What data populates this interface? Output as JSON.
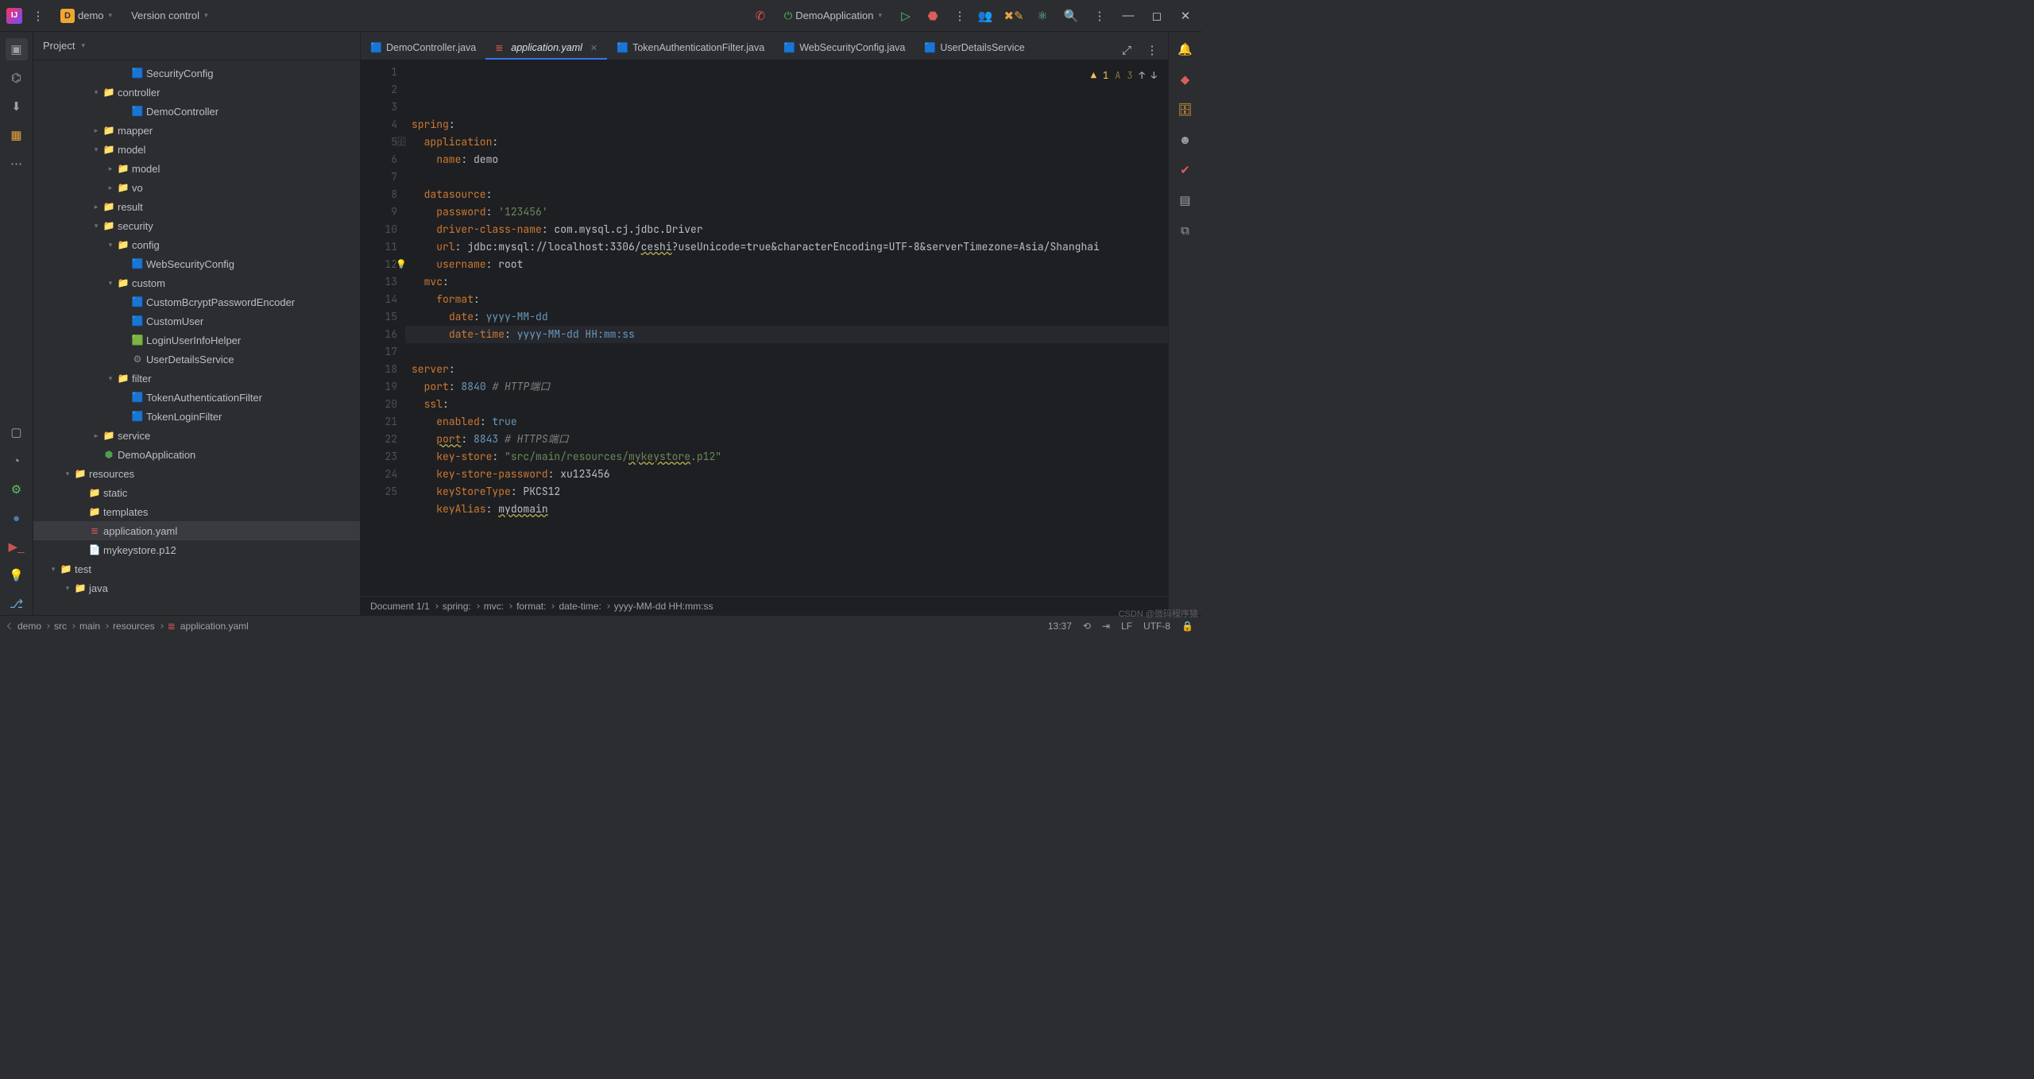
{
  "titlebar": {
    "project_letter": "D",
    "project_name": "demo",
    "vcs": "Version control",
    "run_config": "DemoApplication"
  },
  "sidebar": {
    "title": "Project"
  },
  "tree": [
    {
      "indent": 6,
      "chev": "",
      "icon": "🟦",
      "label": "SecurityConfig",
      "iconColor": "#40a0d8"
    },
    {
      "indent": 4,
      "chev": "▾",
      "icon": "📁",
      "label": "controller",
      "iconColor": "#b07b46"
    },
    {
      "indent": 6,
      "chev": "",
      "icon": "🟦",
      "label": "DemoController",
      "iconColor": "#40a0d8"
    },
    {
      "indent": 4,
      "chev": "▸",
      "icon": "📁",
      "label": "mapper",
      "iconColor": "#4f9e4f"
    },
    {
      "indent": 4,
      "chev": "▾",
      "icon": "📁",
      "label": "model",
      "iconColor": "#4f9e4f"
    },
    {
      "indent": 5,
      "chev": "▸",
      "icon": "📁",
      "label": "model",
      "iconColor": "#4f9e4f"
    },
    {
      "indent": 5,
      "chev": "▸",
      "icon": "📁",
      "label": "vo",
      "iconColor": "#4f9e4f"
    },
    {
      "indent": 4,
      "chev": "▸",
      "icon": "📁",
      "label": "result",
      "iconColor": "#b07b46"
    },
    {
      "indent": 4,
      "chev": "▾",
      "icon": "📁",
      "label": "security",
      "iconColor": "#b07b46"
    },
    {
      "indent": 5,
      "chev": "▾",
      "icon": "📁",
      "label": "config",
      "iconColor": "#4f9e4f"
    },
    {
      "indent": 6,
      "chev": "",
      "icon": "🟦",
      "label": "WebSecurityConfig",
      "iconColor": "#40a0d8"
    },
    {
      "indent": 5,
      "chev": "▾",
      "icon": "📁",
      "label": "custom",
      "iconColor": "#4f9e4f"
    },
    {
      "indent": 6,
      "chev": "",
      "icon": "🟦",
      "label": "CustomBcryptPasswordEncoder",
      "iconColor": "#40a0d8"
    },
    {
      "indent": 6,
      "chev": "",
      "icon": "🟦",
      "label": "CustomUser",
      "iconColor": "#40a0d8"
    },
    {
      "indent": 6,
      "chev": "",
      "icon": "🟩",
      "label": "LoginUserInfoHelper",
      "iconColor": "#4f9e4f"
    },
    {
      "indent": 6,
      "chev": "",
      "icon": "⚙",
      "label": "UserDetailsService",
      "iconColor": "#8a8d93"
    },
    {
      "indent": 5,
      "chev": "▾",
      "icon": "📁",
      "label": "filter",
      "iconColor": "#4f9e4f"
    },
    {
      "indent": 6,
      "chev": "",
      "icon": "🟦",
      "label": "TokenAuthenticationFilter",
      "iconColor": "#40a0d8"
    },
    {
      "indent": 6,
      "chev": "",
      "icon": "🟦",
      "label": "TokenLoginFilter",
      "iconColor": "#40a0d8"
    },
    {
      "indent": 4,
      "chev": "▸",
      "icon": "📁",
      "label": "service",
      "iconColor": "#4f9e4f"
    },
    {
      "indent": 4,
      "chev": "",
      "icon": "⬢",
      "label": "DemoApplication",
      "iconColor": "#4f9e4f"
    },
    {
      "indent": 2,
      "chev": "▾",
      "icon": "📁",
      "label": "resources",
      "iconColor": "#6f7fd8"
    },
    {
      "indent": 3,
      "chev": "",
      "icon": "📁",
      "label": "static",
      "iconColor": "#3a8fbd"
    },
    {
      "indent": 3,
      "chev": "",
      "icon": "📁",
      "label": "templates",
      "iconColor": "#b07b46"
    },
    {
      "indent": 3,
      "chev": "",
      "icon": "≣",
      "label": "application.yaml",
      "iconColor": "#c75450",
      "selected": true
    },
    {
      "indent": 3,
      "chev": "",
      "icon": "📄",
      "label": "mykeystore.p12",
      "iconColor": "#8a8d93"
    },
    {
      "indent": 1,
      "chev": "▾",
      "icon": "📁",
      "label": "test",
      "iconColor": "#4f9e4f"
    },
    {
      "indent": 2,
      "chev": "▾",
      "icon": "📁",
      "label": "java",
      "iconColor": "#6f7fd8"
    }
  ],
  "tabs": [
    {
      "icon": "🟦",
      "label": "DemoController.java",
      "iconColor": "#40a0d8"
    },
    {
      "icon": "≣",
      "label": "application.yaml",
      "iconColor": "#c75450",
      "active": true,
      "italic": true
    },
    {
      "icon": "🟦",
      "label": "TokenAuthenticationFilter.java",
      "iconColor": "#40a0d8"
    },
    {
      "icon": "🟦",
      "label": "WebSecurityConfig.java",
      "iconColor": "#40a0d8"
    },
    {
      "icon": "🟦",
      "label": "UserDetailsService",
      "iconColor": "#40a0d8"
    }
  ],
  "code": [
    {
      "n": 1,
      "seg": [
        {
          "t": "spring",
          "c": "k-key"
        },
        {
          "t": ":",
          "c": ""
        }
      ]
    },
    {
      "n": 2,
      "seg": [
        {
          "t": "  ",
          "c": ""
        },
        {
          "t": "application",
          "c": "k-key"
        },
        {
          "t": ":",
          "c": ""
        }
      ]
    },
    {
      "n": 3,
      "seg": [
        {
          "t": "    ",
          "c": ""
        },
        {
          "t": "name",
          "c": "k-key"
        },
        {
          "t": ": demo",
          "c": ""
        }
      ]
    },
    {
      "n": 4,
      "seg": []
    },
    {
      "n": 5,
      "seg": [
        {
          "t": "  ",
          "c": ""
        },
        {
          "t": "datasource",
          "c": "k-key"
        },
        {
          "t": ":",
          "c": ""
        }
      ],
      "gicon": "🗄"
    },
    {
      "n": 6,
      "seg": [
        {
          "t": "    ",
          "c": ""
        },
        {
          "t": "password",
          "c": "k-key"
        },
        {
          "t": ": ",
          "c": ""
        },
        {
          "t": "'123456'",
          "c": "k-str"
        }
      ]
    },
    {
      "n": 7,
      "seg": [
        {
          "t": "    ",
          "c": ""
        },
        {
          "t": "driver-class-name",
          "c": "k-key"
        },
        {
          "t": ": com.mysql.cj.jdbc.Driver",
          "c": ""
        }
      ]
    },
    {
      "n": 8,
      "seg": [
        {
          "t": "    ",
          "c": ""
        },
        {
          "t": "url",
          "c": "k-key"
        },
        {
          "t": ": jdbc:mysql://localhost:3306/",
          "c": ""
        },
        {
          "t": "ceshi",
          "c": "k-warn"
        },
        {
          "t": "?useUnicode=true&characterEncoding=UTF-8&serverTimezone=Asia/Shanghai",
          "c": ""
        }
      ]
    },
    {
      "n": 9,
      "seg": [
        {
          "t": "    ",
          "c": ""
        },
        {
          "t": "username",
          "c": "k-key"
        },
        {
          "t": ": root",
          "c": ""
        }
      ]
    },
    {
      "n": 10,
      "seg": [
        {
          "t": "  ",
          "c": ""
        },
        {
          "t": "mvc",
          "c": "k-key"
        },
        {
          "t": ":",
          "c": ""
        }
      ]
    },
    {
      "n": 11,
      "seg": [
        {
          "t": "    ",
          "c": ""
        },
        {
          "t": "format",
          "c": "k-key"
        },
        {
          "t": ":",
          "c": ""
        }
      ]
    },
    {
      "n": 12,
      "seg": [
        {
          "t": "      ",
          "c": ""
        },
        {
          "t": "date",
          "c": "k-key"
        },
        {
          "t": ": ",
          "c": ""
        },
        {
          "t": "yyyy-MM-dd",
          "c": "k-val"
        }
      ],
      "gicon": "💡"
    },
    {
      "n": 13,
      "seg": [
        {
          "t": "      ",
          "c": ""
        },
        {
          "t": "date-time",
          "c": "k-key"
        },
        {
          "t": ": ",
          "c": ""
        },
        {
          "t": "yyyy-MM-dd HH:mm:ss",
          "c": "k-val"
        }
      ],
      "cur": true
    },
    {
      "n": 14,
      "seg": []
    },
    {
      "n": 15,
      "seg": [
        {
          "t": "server",
          "c": "k-key"
        },
        {
          "t": ":",
          "c": ""
        }
      ]
    },
    {
      "n": 16,
      "seg": [
        {
          "t": "  ",
          "c": ""
        },
        {
          "t": "port",
          "c": "k-key"
        },
        {
          "t": ": ",
          "c": ""
        },
        {
          "t": "8840",
          "c": "k-val"
        },
        {
          "t": " ",
          "c": ""
        },
        {
          "t": "# HTTP端口",
          "c": "k-cmt"
        }
      ]
    },
    {
      "n": 17,
      "seg": [
        {
          "t": "  ",
          "c": ""
        },
        {
          "t": "ssl",
          "c": "k-key"
        },
        {
          "t": ":",
          "c": ""
        }
      ]
    },
    {
      "n": 18,
      "seg": [
        {
          "t": "    ",
          "c": ""
        },
        {
          "t": "enabled",
          "c": "k-key"
        },
        {
          "t": ": ",
          "c": ""
        },
        {
          "t": "true",
          "c": "k-val"
        }
      ]
    },
    {
      "n": 19,
      "seg": [
        {
          "t": "    ",
          "c": ""
        },
        {
          "t": "port",
          "c": "k-key k-warn"
        },
        {
          "t": ": ",
          "c": ""
        },
        {
          "t": "8843",
          "c": "k-val"
        },
        {
          "t": " ",
          "c": ""
        },
        {
          "t": "# HTTPS端口",
          "c": "k-cmt"
        }
      ]
    },
    {
      "n": 20,
      "seg": [
        {
          "t": "    ",
          "c": ""
        },
        {
          "t": "key-store",
          "c": "k-key"
        },
        {
          "t": ": ",
          "c": ""
        },
        {
          "t": "\"src/main/resources/",
          "c": "k-str"
        },
        {
          "t": "mykeystore",
          "c": "k-str k-warn"
        },
        {
          "t": ".p12\"",
          "c": "k-str"
        }
      ]
    },
    {
      "n": 21,
      "seg": [
        {
          "t": "    ",
          "c": ""
        },
        {
          "t": "key-store-password",
          "c": "k-key"
        },
        {
          "t": ": xu123456",
          "c": ""
        }
      ]
    },
    {
      "n": 22,
      "seg": [
        {
          "t": "    ",
          "c": ""
        },
        {
          "t": "keyStoreType",
          "c": "k-key"
        },
        {
          "t": ": PKCS12",
          "c": ""
        }
      ]
    },
    {
      "n": 23,
      "seg": [
        {
          "t": "    ",
          "c": ""
        },
        {
          "t": "keyAlias",
          "c": "k-key"
        },
        {
          "t": ": ",
          "c": ""
        },
        {
          "t": "mydomain",
          "c": "k-warn"
        }
      ]
    },
    {
      "n": 24,
      "seg": []
    },
    {
      "n": 25,
      "seg": []
    }
  ],
  "inspection": {
    "warnings": "1",
    "weak": "3"
  },
  "crumbs": [
    "Document 1/1",
    "spring:",
    "mvc:",
    "format:",
    "date-time:",
    "yyyy-MM-dd HH:mm:ss"
  ],
  "path_crumbs": [
    "demo",
    "src",
    "main",
    "resources",
    "application.yaml"
  ],
  "status": {
    "time": "13:37",
    "sep": "LF",
    "enc": "UTF-8",
    "lock": "🔒"
  },
  "watermark": "CSDN @微码程序猿"
}
